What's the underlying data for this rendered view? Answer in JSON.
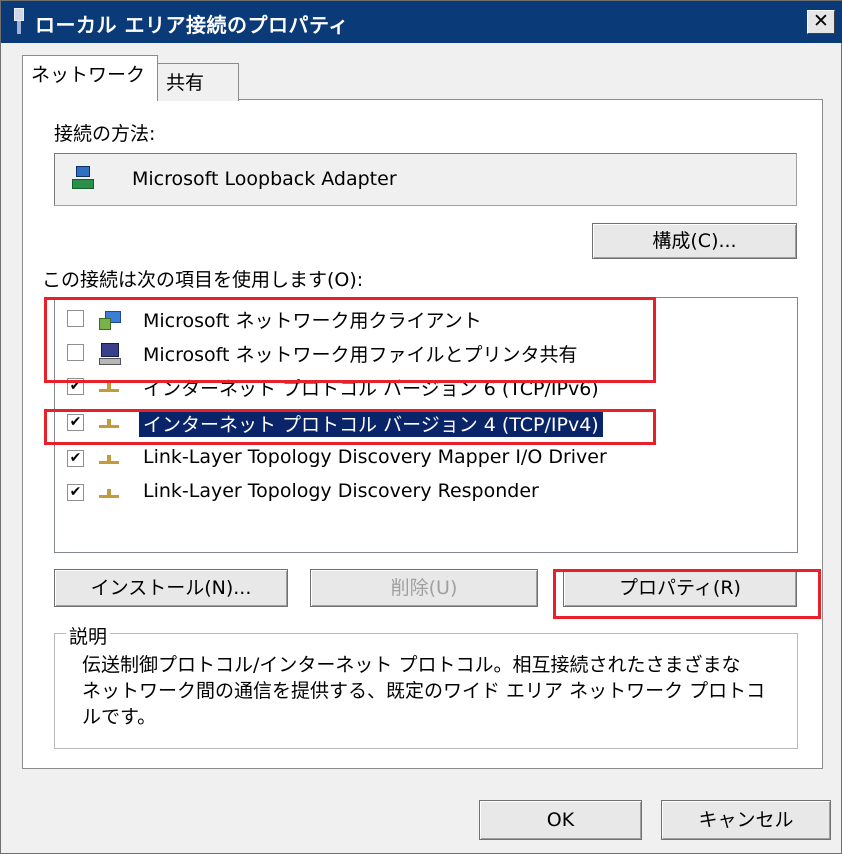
{
  "window": {
    "title": "ローカル エリア接続のプロパティ",
    "close_label": "✕"
  },
  "tabs": [
    {
      "label": "ネットワーク",
      "selected": true
    },
    {
      "label": "共有",
      "selected": false
    }
  ],
  "connection": {
    "label": "接続の方法:",
    "adapter": "Microsoft Loopback Adapter",
    "configure_button": "構成(C)..."
  },
  "items": {
    "label": "この接続は次の項目を使用します(O):",
    "list": [
      {
        "label": "Microsoft ネットワーク用クライアント",
        "checked": false,
        "icon": "network-client-icon"
      },
      {
        "label": "Microsoft ネットワーク用ファイルとプリンタ共有",
        "checked": false,
        "icon": "computer-share-icon"
      },
      {
        "label": "インターネット プロトコル バージョン 6 (TCP/IPv6)",
        "checked": true,
        "icon": "protocol-icon"
      },
      {
        "label": "インターネット プロトコル バージョン 4 (TCP/IPv4)",
        "checked": true,
        "icon": "protocol-icon",
        "selected": true
      },
      {
        "label": "Link-Layer Topology Discovery Mapper I/O Driver",
        "checked": true,
        "icon": "protocol-icon"
      },
      {
        "label": "Link-Layer Topology Discovery Responder",
        "checked": true,
        "icon": "protocol-icon"
      }
    ]
  },
  "buttons": {
    "install": "インストール(N)...",
    "uninstall": "削除(U)",
    "properties": "プロパティ(R)",
    "ok": "OK",
    "cancel": "キャンセル"
  },
  "description": {
    "title": "説明",
    "text_line1": "伝送制御プロトコル/インターネット プロトコル。相互接続されたさまざまな",
    "text_line2": "ネットワーク間の通信を提供する、既定のワイド エリア ネットワーク プロトコ",
    "text_line3": "ルです。"
  },
  "colors": {
    "title_bar": "#0b3a78",
    "selection": "#0a246a",
    "highlight": "#e8202a"
  }
}
